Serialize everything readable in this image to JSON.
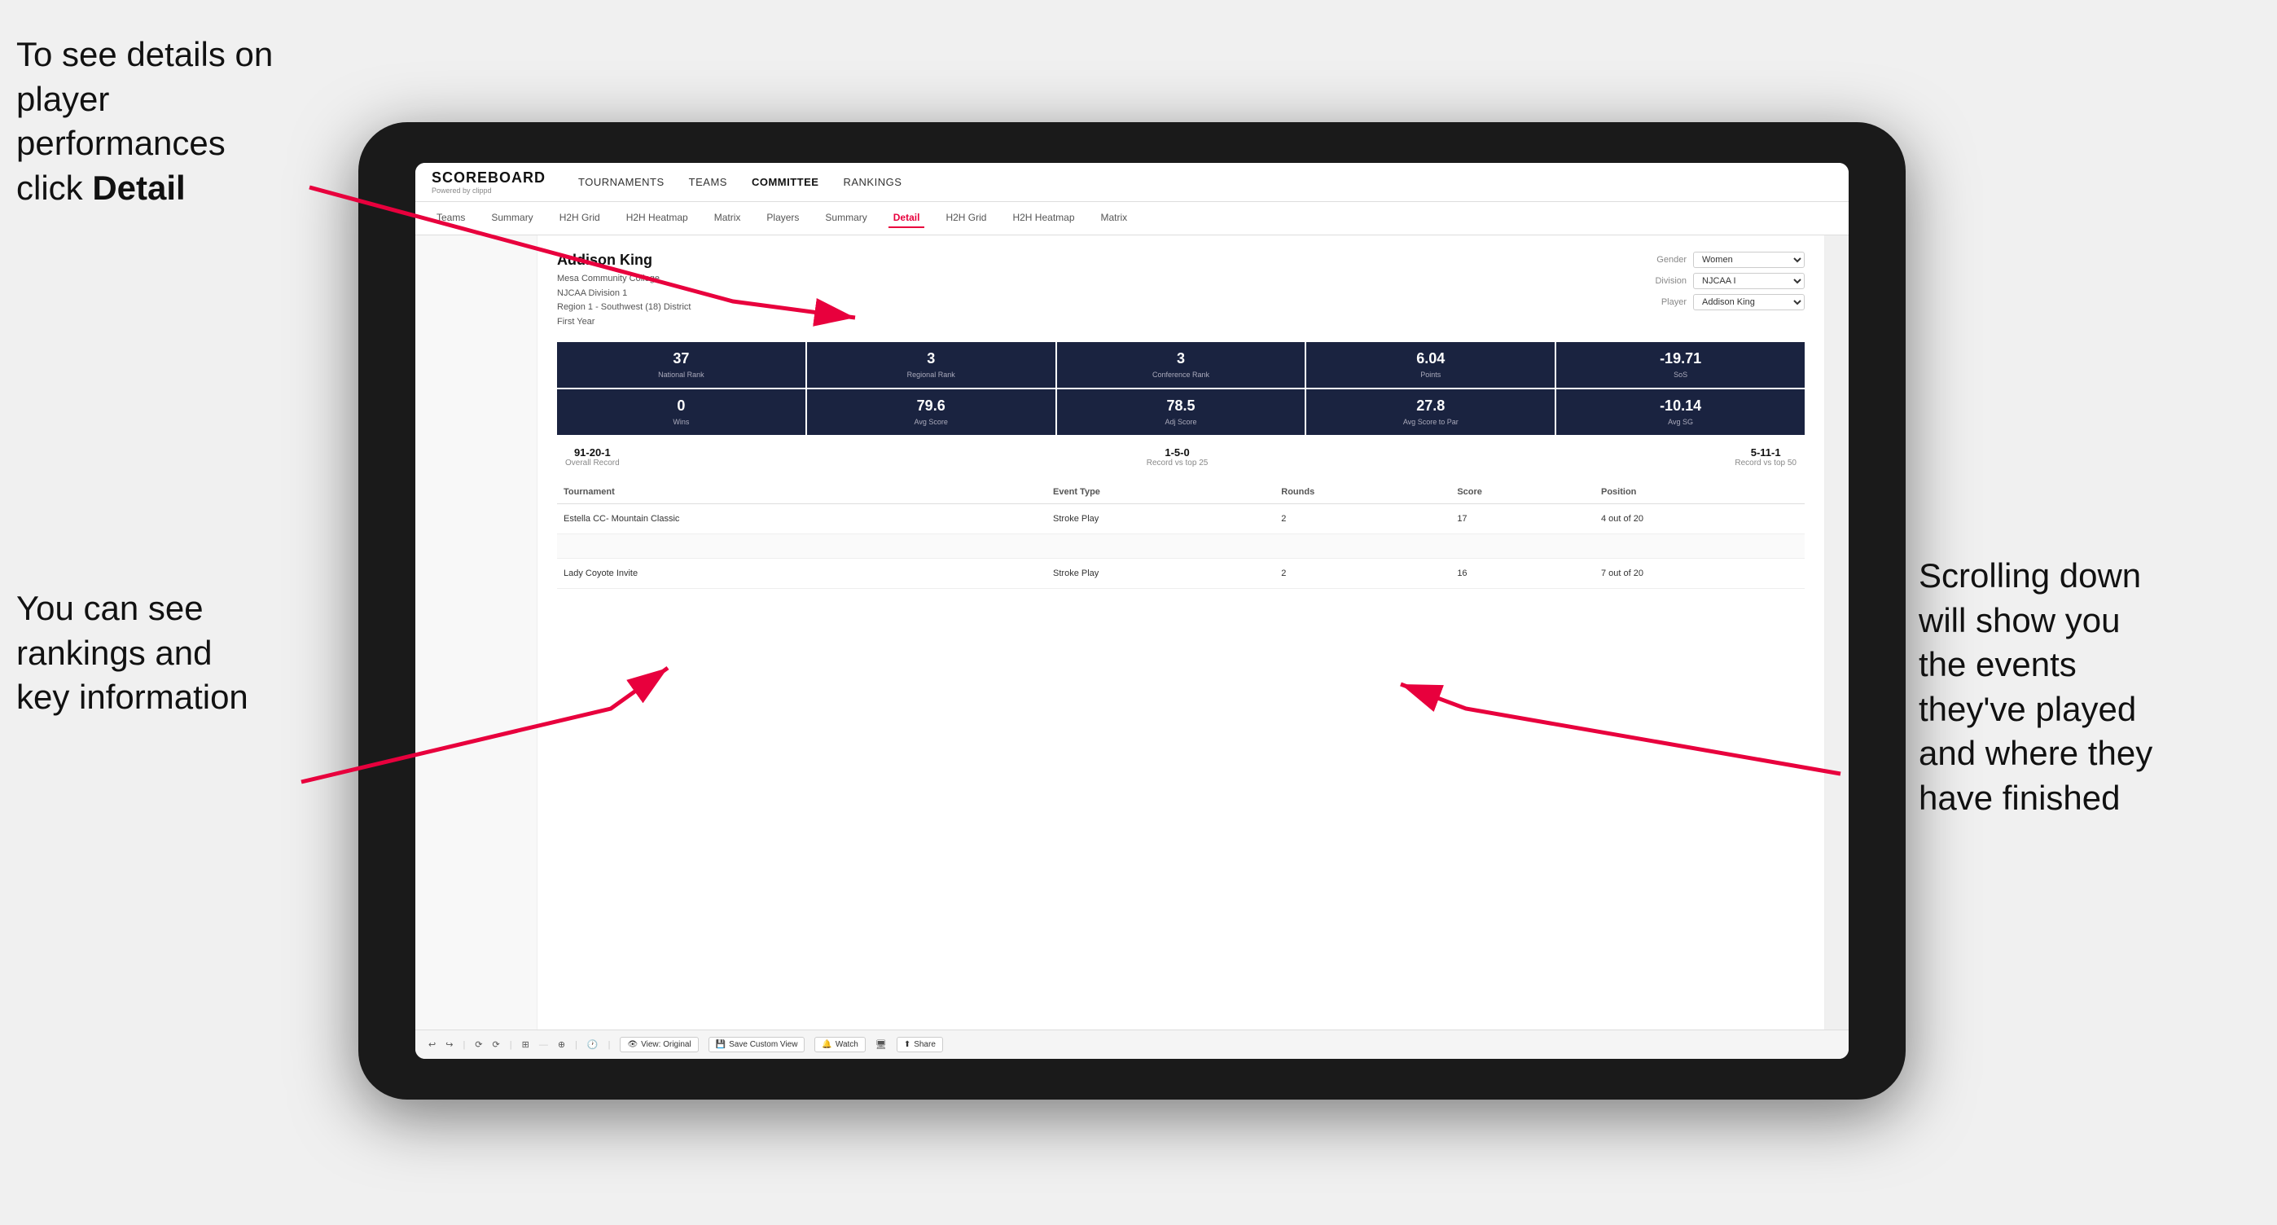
{
  "annotations": {
    "topleft": {
      "line1": "To see details on",
      "line2": "player performances",
      "line3_pre": "click ",
      "line3_bold": "Detail"
    },
    "bottomleft": {
      "line1": "You can see",
      "line2": "rankings and",
      "line3": "key information"
    },
    "right": {
      "line1": "Scrolling down",
      "line2": "will show you",
      "line3": "the events",
      "line4": "they've played",
      "line5": "and where they",
      "line6": "have finished"
    }
  },
  "nav": {
    "logo": "SCOREBOARD",
    "logo_sub": "Powered by clippd",
    "items": [
      "TOURNAMENTS",
      "TEAMS",
      "COMMITTEE",
      "RANKINGS"
    ]
  },
  "sub_nav": {
    "items": [
      "Teams",
      "Summary",
      "H2H Grid",
      "H2H Heatmap",
      "Matrix",
      "Players",
      "Summary",
      "Detail",
      "H2H Grid",
      "H2H Heatmap",
      "Matrix"
    ]
  },
  "player": {
    "name": "Addison King",
    "school": "Mesa Community College",
    "division": "NJCAA Division 1",
    "region": "Region 1 - Southwest (18) District",
    "year": "First Year",
    "gender_label": "Gender",
    "gender_value": "Women",
    "division_label": "Division",
    "division_value": "NJCAA I",
    "player_label": "Player",
    "player_value": "Addison King"
  },
  "stats_row1": [
    {
      "value": "37",
      "label": "National Rank"
    },
    {
      "value": "3",
      "label": "Regional Rank"
    },
    {
      "value": "3",
      "label": "Conference Rank"
    },
    {
      "value": "6.04",
      "label": "Points"
    },
    {
      "value": "-19.71",
      "label": "SoS"
    }
  ],
  "stats_row2": [
    {
      "value": "0",
      "label": "Wins"
    },
    {
      "value": "79.6",
      "label": "Avg Score"
    },
    {
      "value": "78.5",
      "label": "Adj Score"
    },
    {
      "value": "27.8",
      "label": "Avg Score to Par"
    },
    {
      "value": "-10.14",
      "label": "Avg SG"
    }
  ],
  "records": [
    {
      "value": "91-20-1",
      "label": "Overall Record"
    },
    {
      "value": "1-5-0",
      "label": "Record vs top 25"
    },
    {
      "value": "5-11-1",
      "label": "Record vs top 50"
    }
  ],
  "table": {
    "headers": [
      "Tournament",
      "Event Type",
      "Rounds",
      "Score",
      "Position"
    ],
    "rows": [
      {
        "tournament": "Estella CC- Mountain Classic",
        "event_type": "Stroke Play",
        "rounds": "2",
        "score": "17",
        "position": "4 out of 20"
      },
      {
        "tournament": "",
        "event_type": "",
        "rounds": "",
        "score": "",
        "position": ""
      },
      {
        "tournament": "Lady Coyote Invite",
        "event_type": "Stroke Play",
        "rounds": "2",
        "score": "16",
        "position": "7 out of 20"
      }
    ]
  },
  "toolbar": {
    "undo": "↩",
    "redo": "↪",
    "view_original": "View: Original",
    "save_custom": "Save Custom View",
    "watch": "Watch",
    "share": "Share"
  }
}
